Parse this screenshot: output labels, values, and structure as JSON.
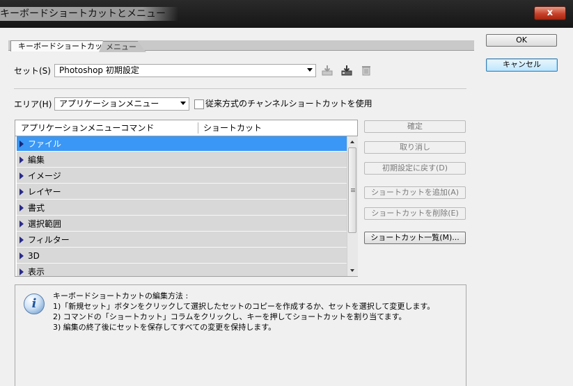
{
  "window": {
    "title": "キーボードショートカットとメニュー",
    "close_symbol": "x"
  },
  "tabs": [
    {
      "label": "キーボードショートカット",
      "active": true
    },
    {
      "label": "メニュー",
      "active": false
    }
  ],
  "set": {
    "label": "セット(S) :",
    "value": "Photoshop 初期設定"
  },
  "area": {
    "label": "エリア(H) :",
    "value": "アプリケーションメニュー",
    "legacy_checkbox_label": "従来方式のチャンネルショートカットを使用",
    "legacy_checked": false
  },
  "table": {
    "columns": [
      "アプリケーションメニューコマンド",
      "ショートカット"
    ],
    "rows": [
      {
        "label": "ファイル",
        "selected": true
      },
      {
        "label": "編集",
        "selected": false
      },
      {
        "label": "イメージ",
        "selected": false
      },
      {
        "label": "レイヤー",
        "selected": false
      },
      {
        "label": "書式",
        "selected": false
      },
      {
        "label": "選択範囲",
        "selected": false
      },
      {
        "label": "フィルター",
        "selected": false
      },
      {
        "label": "3D",
        "selected": false
      },
      {
        "label": "表示",
        "selected": false
      }
    ]
  },
  "side_buttons": {
    "confirm": "確定",
    "undo": "取り消し",
    "reset": "初期設定に戻す(D)",
    "add": "ショートカットを追加(A)",
    "delete": "ショートカットを削除(E)",
    "summary": "ショートカット一覧(M)..."
  },
  "help": {
    "heading": "キーボードショートカットの編集方法 :",
    "lines": [
      "1)「新規セット」ボタンをクリックして選択したセットのコピーを作成するか、セットを選択して変更します。",
      "2) コマンドの「ショートカット」コラムをクリックし、キーを押してショートカットを割り当てます。",
      "3) 編集の終了後にセットを保存してすべての変更を保持します。"
    ]
  },
  "dialog_buttons": {
    "ok": "OK",
    "cancel": "キャンセル"
  },
  "icons": [
    "save-set-icon",
    "save-set-as-icon",
    "delete-set-icon",
    "info-icon"
  ]
}
